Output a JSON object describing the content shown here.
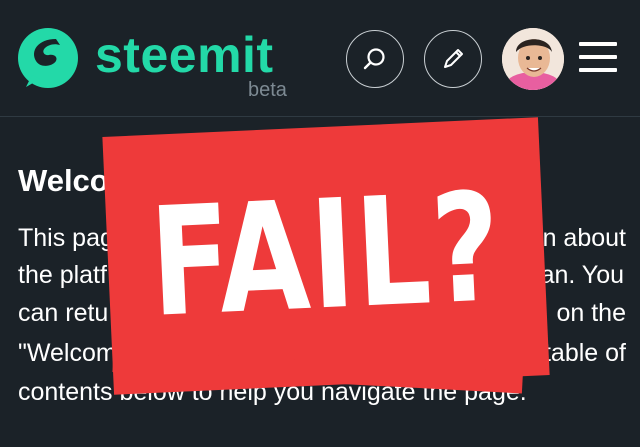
{
  "header": {
    "brand_name": "steemit",
    "brand_tag": "beta",
    "brand_color": "#23d9a8",
    "search_icon": "search-icon",
    "edit_icon": "pencil-icon",
    "menu_icon": "hamburger-icon"
  },
  "content": {
    "heading_visible": "Welco",
    "lines": [
      {
        "left": "This page",
        "right": "rn about"
      },
      {
        "left": "the platf",
        "right": "an. You"
      },
      {
        "left": "can retu",
        "right": "on the"
      },
      {
        "left": "\"Welcome\" link in the main menu. Th",
        "right": "table of"
      },
      {
        "left": "contents below to help you navigate the page.",
        "right": ""
      }
    ]
  },
  "overlay": {
    "text": "FAIL?",
    "color": "#ee3a3a"
  }
}
